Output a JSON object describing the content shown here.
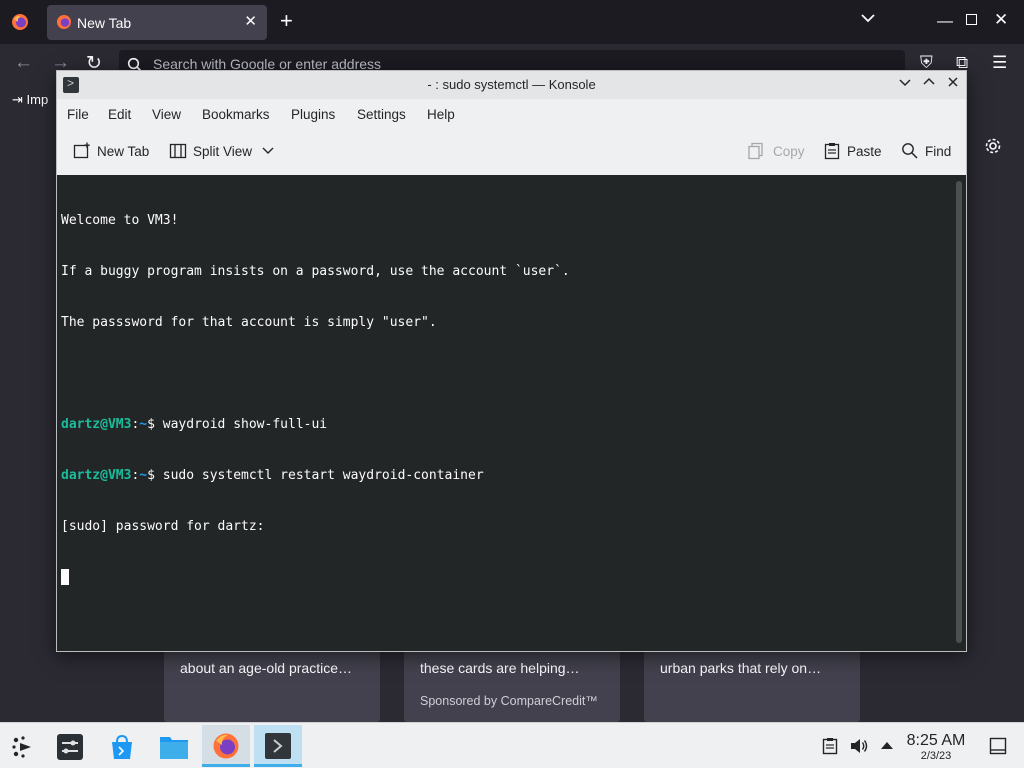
{
  "firefox": {
    "tab_title": "New Tab",
    "url_placeholder": "Search with Google or enter address",
    "bookmark_import": "Imp",
    "cards": [
      {
        "text": "about an age-old practice…",
        "sponsor": ""
      },
      {
        "text": "these cards are helping…",
        "sponsor": "Sponsored by CompareCredit™"
      },
      {
        "text": "urban parks that rely on…",
        "sponsor": ""
      }
    ]
  },
  "konsole": {
    "title": "- : sudo systemctl — Konsole",
    "menu": [
      "File",
      "Edit",
      "View",
      "Bookmarks",
      "Plugins",
      "Settings",
      "Help"
    ],
    "toolbar": {
      "new_tab": "New Tab",
      "split_view": "Split View",
      "copy": "Copy",
      "paste": "Paste",
      "find": "Find"
    },
    "terminal": {
      "welcome": "Welcome to VM3!",
      "line2": "If a buggy program insists on a password, use the account `user`.",
      "line3": "The passsword for that account is simply \"user\".",
      "prompt_user": "dartz@VM3",
      "prompt_sep": ":",
      "prompt_path": "~",
      "prompt_dollar": "$ ",
      "cmd1": "waydroid show-full-ui",
      "cmd2": "sudo systemctl restart waydroid-container",
      "sudo_prompt": "[sudo] password for dartz:"
    }
  },
  "taskbar": {
    "time": "8:25 AM",
    "date": "2/3/23"
  },
  "colors": {
    "terminal_bg": "#232627",
    "prompt_user": "#1abc9c",
    "prompt_path": "#1d99f3",
    "accent": "#3daee9"
  }
}
